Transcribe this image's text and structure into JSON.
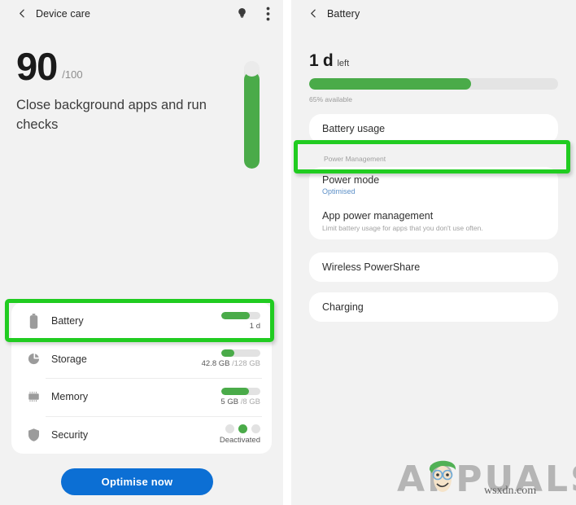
{
  "left_panel": {
    "header": {
      "back_icon": "chevron-left-icon",
      "title": "Device care",
      "bulb_icon": "lightbulb-icon",
      "menu_icon": "kebab-menu-icon"
    },
    "score": {
      "value": "90",
      "denominator": "/100",
      "description": "Close background apps and run checks",
      "gauge_percent": 90
    },
    "status_rows": [
      {
        "icon": "battery-icon",
        "label": "Battery",
        "bar_percent": 72,
        "value": "1 d",
        "value_muted": "",
        "type": "bar",
        "highlighted": true
      },
      {
        "icon": "storage-pie-icon",
        "label": "Storage",
        "bar_percent": 33,
        "value": "42.8 GB",
        "value_muted": "/128 GB",
        "type": "bar",
        "highlighted": false
      },
      {
        "icon": "memory-chip-icon",
        "label": "Memory",
        "bar_percent": 70,
        "value": "5 GB",
        "value_muted": "/8 GB",
        "type": "bar",
        "highlighted": false
      },
      {
        "icon": "shield-icon",
        "label": "Security",
        "value": "Deactivated",
        "value_muted": "",
        "type": "dots",
        "dots_active_index": 1,
        "dots_count": 3,
        "highlighted": false
      }
    ],
    "cta_label": "Optimise now",
    "cta_color": "#0c6fd4"
  },
  "right_panel": {
    "header": {
      "back_icon": "chevron-left-icon",
      "title": "Battery"
    },
    "remaining": {
      "number": "1 d",
      "unit": "left"
    },
    "battery_bar": {
      "percent": 65,
      "caption": "65% available",
      "fill_color": "#4aab49"
    },
    "battery_usage_label": "Battery usage",
    "section_label": "Power Management",
    "power_mode": {
      "title": "Power mode",
      "value": "Optimised",
      "value_color": "#5b8fc7",
      "highlighted": true
    },
    "app_power_management": {
      "title": "App power management",
      "subtitle": "Limit battery usage for apps that you don't use often."
    },
    "wireless_powershare_label": "Wireless PowerShare",
    "charging_label": "Charging"
  },
  "highlight": {
    "color": "#21cc21"
  },
  "watermark": {
    "brand": "APPUALS",
    "url": "wsxdn.com"
  }
}
